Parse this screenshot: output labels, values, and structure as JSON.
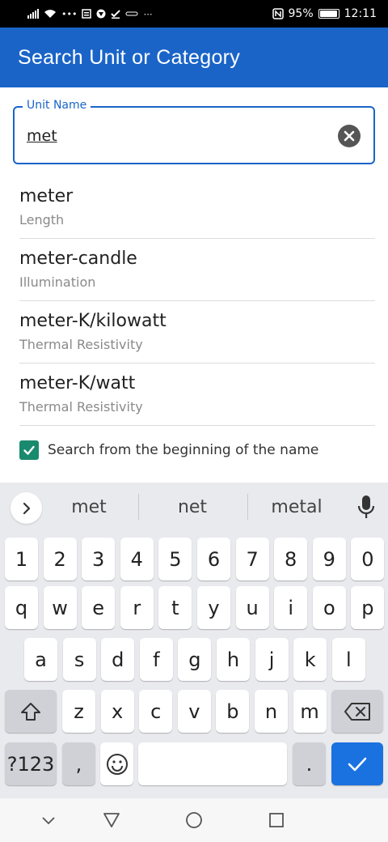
{
  "status_bar": {
    "battery_text": "95%",
    "time": "12:11",
    "battery_level": 0.95,
    "icons": [
      "signal-icon",
      "wifi-icon",
      "dots-icon",
      "sim-icon",
      "vpn-icon",
      "check-icon",
      "photos-icon",
      "more-icon",
      "nfc-icon",
      "battery-icon"
    ]
  },
  "app_bar": {
    "title": "Search Unit or Category"
  },
  "search": {
    "label": "Unit Name",
    "value": "met"
  },
  "results": [
    {
      "name": "meter",
      "category": "Length"
    },
    {
      "name": "meter-candle",
      "category": "Illumination"
    },
    {
      "name": "meter-K/kilowatt",
      "category": "Thermal Resistivity"
    },
    {
      "name": "meter-K/watt",
      "category": "Thermal Resistivity"
    }
  ],
  "options": {
    "search_from_beginning_label": "Search from the beginning of the name",
    "search_from_beginning_checked": true
  },
  "keyboard": {
    "suggestions": [
      "met",
      "net",
      "metal"
    ],
    "row_numbers": [
      "1",
      "2",
      "3",
      "4",
      "5",
      "6",
      "7",
      "8",
      "9",
      "0"
    ],
    "row_top": [
      "q",
      "w",
      "e",
      "r",
      "t",
      "y",
      "u",
      "i",
      "o",
      "p"
    ],
    "row_middle": [
      "a",
      "s",
      "d",
      "f",
      "g",
      "h",
      "j",
      "k",
      "l"
    ],
    "row_bottom": [
      "z",
      "x",
      "c",
      "v",
      "b",
      "n",
      "m"
    ],
    "symbols_label": "?123",
    "comma_label": ",",
    "period_label": "."
  },
  "colors": {
    "primary": "#1a64c8",
    "checkbox": "#1a8a6e",
    "enter_key": "#1a72e0"
  }
}
